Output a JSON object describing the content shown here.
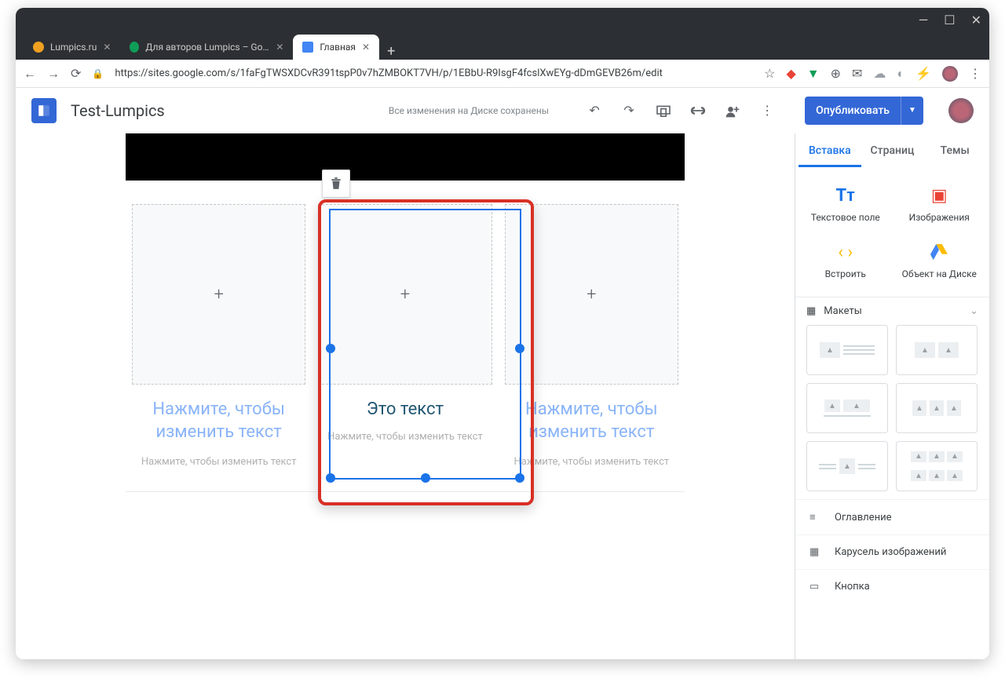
{
  "window": {
    "minimize": "—",
    "maximize": "☐",
    "close": "✕"
  },
  "tabs": [
    {
      "label": "Lumpics.ru",
      "favicon": "#f0a020",
      "active": false
    },
    {
      "label": "Для авторов Lumpics – Google Д",
      "favicon": "#0f9d58",
      "active": false
    },
    {
      "label": "Главная",
      "favicon": "#4285f4",
      "active": true
    }
  ],
  "address": {
    "url": "https://sites.google.com/s/1faFgTWSXDCvR391tspP0v7hZMBOKT7VH/p/1EBbU-R9IsgF4fcslXwEYg-dDmGEVB26m/edit"
  },
  "app": {
    "siteName": "Test-Lumpics",
    "saveStatus": "Все изменения на Диске сохранены",
    "publish": "Опубликовать"
  },
  "canvas": {
    "cards": [
      {
        "title": "Нажмите, чтобы изменить текст",
        "sub": "Нажмите, чтобы изменить текст"
      },
      {
        "title": "Это текст",
        "sub": "Нажмите, чтобы изменить текст"
      },
      {
        "title": "Нажмите, чтобы изменить текст",
        "sub": "Нажмите, чтобы изменить текст"
      }
    ]
  },
  "sidebar": {
    "tabs": [
      "Вставка",
      "Страниц",
      "Темы"
    ],
    "insert": [
      {
        "label": "Текстовое поле",
        "icon": "Tᴛ",
        "color": "#1a73e8"
      },
      {
        "label": "Изображения",
        "icon": "▣",
        "color": "#ea4335"
      },
      {
        "label": "Встроить",
        "icon": "‹ ›",
        "color": "#fbbc04"
      },
      {
        "label": "Объект на Диске",
        "icon": "▲",
        "color": "#0f9d58"
      }
    ],
    "layoutsHeader": "Макеты",
    "lists": [
      {
        "icon": "≡",
        "label": "Оглавление"
      },
      {
        "icon": "▦",
        "label": "Карусель изображений"
      },
      {
        "icon": "▭",
        "label": "Кнопка"
      }
    ]
  }
}
